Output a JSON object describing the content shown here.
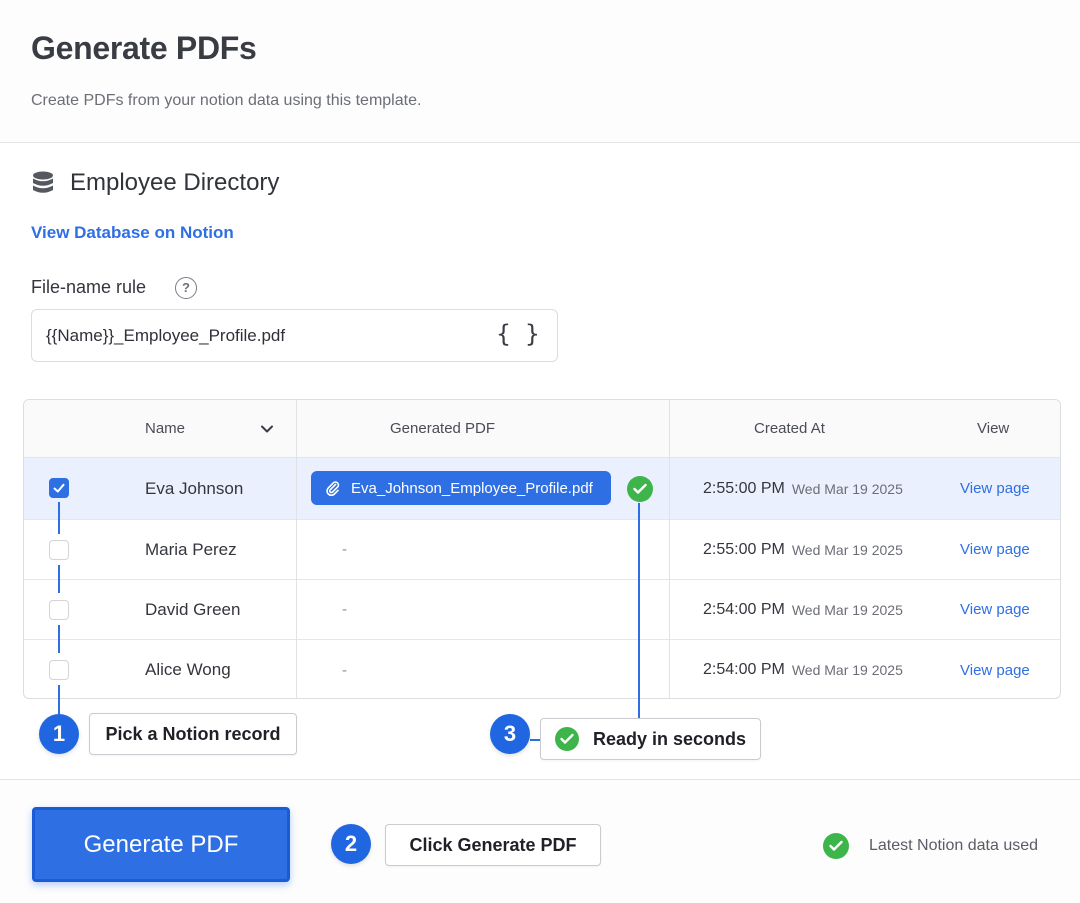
{
  "header": {
    "title": "Generate PDFs",
    "subtitle": "Create PDFs from your notion data using this template."
  },
  "database": {
    "title": "Employee Directory",
    "link": "View Database on Notion",
    "icon": "database-icon"
  },
  "filename_rule": {
    "label": "File-name rule",
    "help": "?",
    "value": "{{Name}}_Employee_Profile.pdf",
    "variables_icon": "{ }"
  },
  "table": {
    "columns": [
      "Name",
      "Generated PDF",
      "Created At",
      "View"
    ],
    "rows": [
      {
        "checked": true,
        "name": "Eva Johnson",
        "pdf": "Eva_Johnson_Employee_Profile.pdf",
        "time": "2:55:00 PM",
        "date": "Wed Mar 19 2025",
        "view": "View page"
      },
      {
        "checked": false,
        "name": "Maria Perez",
        "pdf": "-",
        "time": "2:55:00 PM",
        "date": "Wed Mar 19 2025",
        "view": "View page"
      },
      {
        "checked": false,
        "name": "David Green",
        "pdf": "-",
        "time": "2:54:00 PM",
        "date": "Wed Mar 19 2025",
        "view": "View page"
      },
      {
        "checked": false,
        "name": "Alice Wong",
        "pdf": "-",
        "time": "2:54:00 PM",
        "date": "Wed Mar 19 2025",
        "view": "View page"
      }
    ]
  },
  "steps": [
    {
      "number": "1",
      "label": "Pick a Notion record"
    },
    {
      "number": "2",
      "label": "Click Generate PDF"
    },
    {
      "number": "3",
      "label": "Ready in seconds"
    }
  ],
  "footer": {
    "button": "Generate PDF",
    "status": "Latest Notion data used"
  },
  "colors": {
    "accent": "#2f6fe4",
    "success": "#3db54a",
    "selected_row": "#eaf0fd"
  }
}
